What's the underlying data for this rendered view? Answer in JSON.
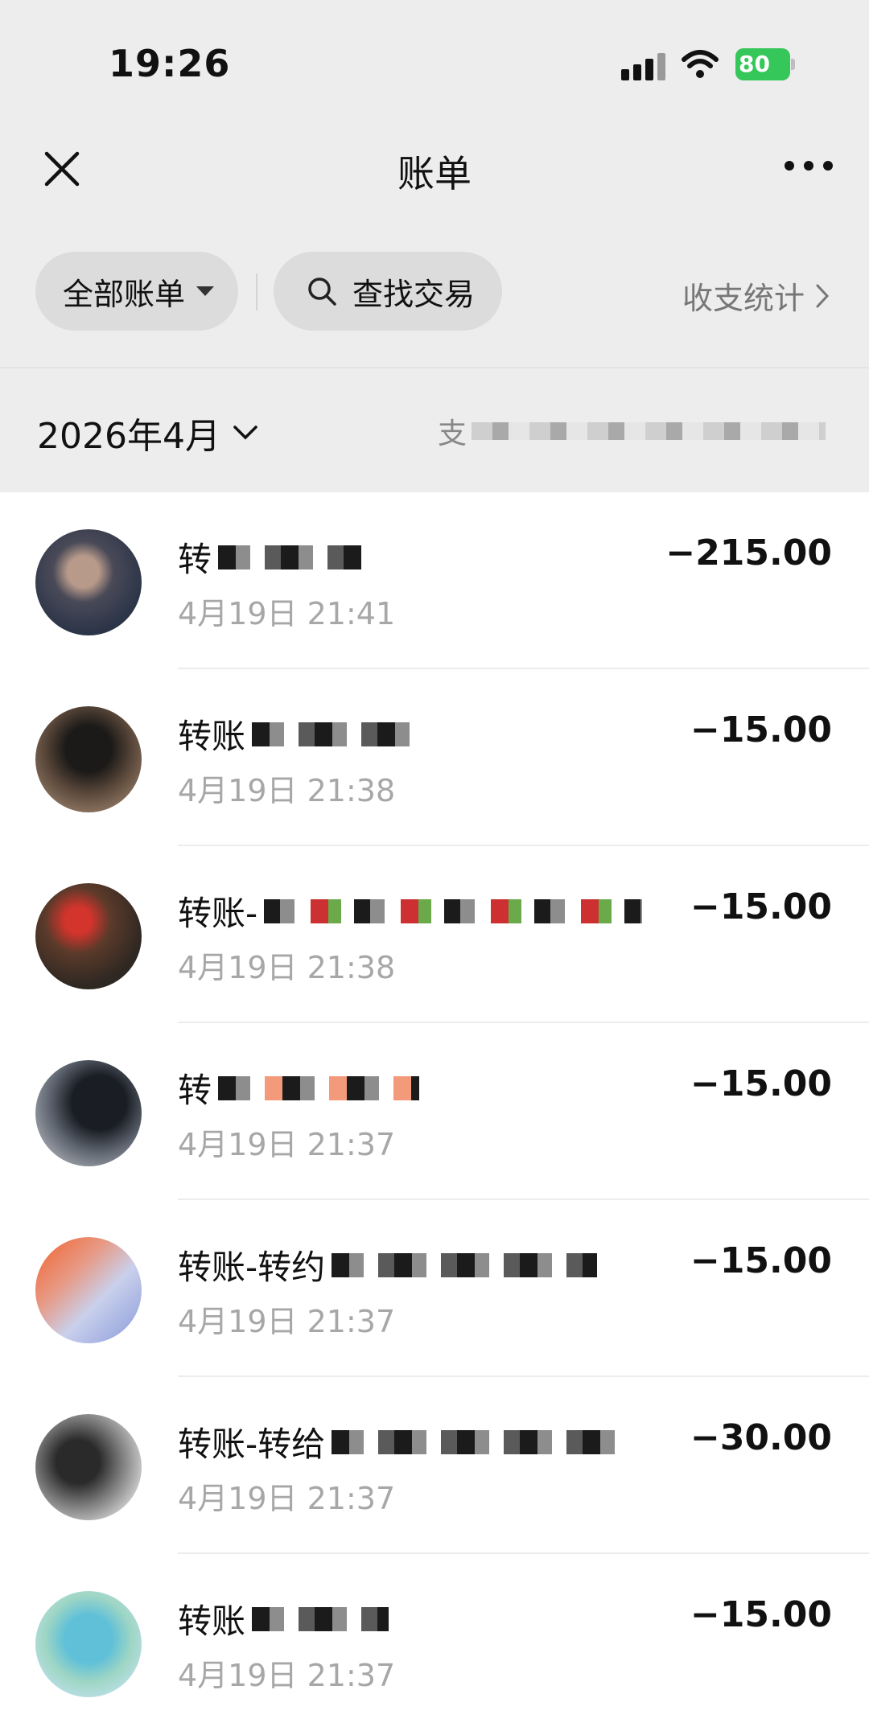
{
  "status_bar": {
    "time": "19:26",
    "battery": "80"
  },
  "nav": {
    "title": "账单"
  },
  "filters": {
    "all_bills": "全部账单",
    "search": "查找交易",
    "stats": "收支统计"
  },
  "month_header": {
    "month": "2026年4月",
    "summary_prefix": "支"
  },
  "transactions": [
    {
      "name": "转",
      "datetime": "4月19日 21:41",
      "amount": "−215.00"
    },
    {
      "name": "转账",
      "datetime": "4月19日 21:38",
      "amount": "−15.00"
    },
    {
      "name": "转账-",
      "datetime": "4月19日 21:38",
      "amount": "−15.00"
    },
    {
      "name": "转",
      "datetime": "4月19日 21:37",
      "amount": "−15.00"
    },
    {
      "name": "转账-转约",
      "datetime": "4月19日 21:37",
      "amount": "−15.00"
    },
    {
      "name": "转账-转给",
      "datetime": "4月19日 21:37",
      "amount": "−30.00"
    },
    {
      "name": "转账",
      "datetime": "4月19日 21:37",
      "amount": "−15.00"
    }
  ],
  "colors": {
    "header_bg": "#ededed",
    "pill_bg": "#dcdcdc",
    "battery_green": "#35c759"
  }
}
